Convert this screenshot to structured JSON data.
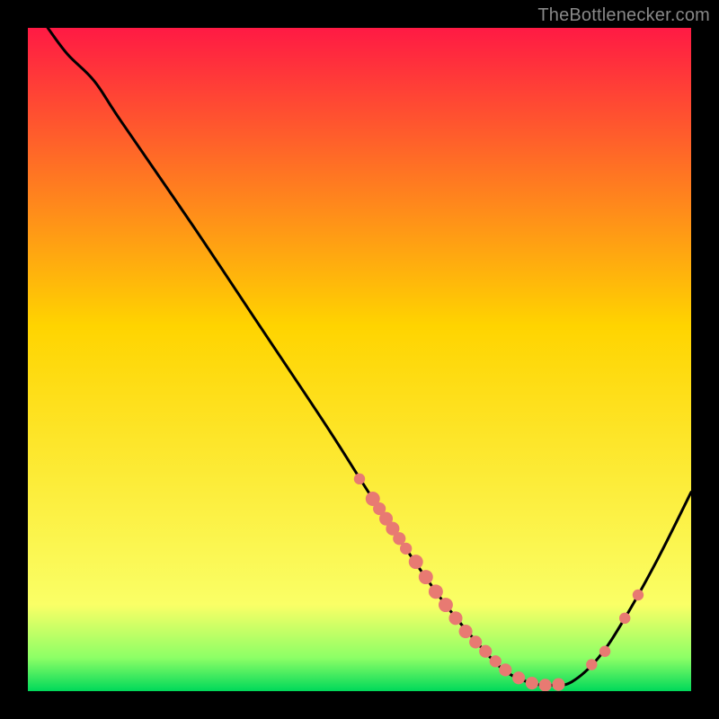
{
  "attribution": "TheBottlenecker.com",
  "colors": {
    "bg": "#000000",
    "curve": "#000000",
    "markers": "#e87a72",
    "grad_top": "#ff1a44",
    "grad_mid": "#ffd400",
    "grad_low1": "#faff66",
    "grad_low2": "#8cff66",
    "grad_bottom": "#00d85a"
  },
  "chart_data": {
    "type": "line",
    "title": "",
    "xlabel": "",
    "ylabel": "",
    "xlim": [
      0,
      100
    ],
    "ylim": [
      0,
      100
    ],
    "curve": [
      {
        "x": 3,
        "y": 100
      },
      {
        "x": 6,
        "y": 96
      },
      {
        "x": 10,
        "y": 92
      },
      {
        "x": 14,
        "y": 86
      },
      {
        "x": 25,
        "y": 70
      },
      {
        "x": 35,
        "y": 55
      },
      {
        "x": 45,
        "y": 40
      },
      {
        "x": 52,
        "y": 29
      },
      {
        "x": 58,
        "y": 20
      },
      {
        "x": 63,
        "y": 13
      },
      {
        "x": 68,
        "y": 7
      },
      {
        "x": 72,
        "y": 3
      },
      {
        "x": 76,
        "y": 1.2
      },
      {
        "x": 79,
        "y": 0.9
      },
      {
        "x": 82,
        "y": 1.4
      },
      {
        "x": 86,
        "y": 5
      },
      {
        "x": 90,
        "y": 11
      },
      {
        "x": 95,
        "y": 20
      },
      {
        "x": 100,
        "y": 30
      }
    ],
    "markers": [
      {
        "x": 50,
        "y": 32,
        "r": 1.4
      },
      {
        "x": 52,
        "y": 29,
        "r": 1.8
      },
      {
        "x": 53,
        "y": 27.5,
        "r": 1.6
      },
      {
        "x": 54,
        "y": 26,
        "r": 1.7
      },
      {
        "x": 55,
        "y": 24.5,
        "r": 1.7
      },
      {
        "x": 56,
        "y": 23,
        "r": 1.6
      },
      {
        "x": 57,
        "y": 21.5,
        "r": 1.5
      },
      {
        "x": 58.5,
        "y": 19.5,
        "r": 1.8
      },
      {
        "x": 60,
        "y": 17.2,
        "r": 1.8
      },
      {
        "x": 61.5,
        "y": 15,
        "r": 1.8
      },
      {
        "x": 63,
        "y": 13,
        "r": 1.8
      },
      {
        "x": 64.5,
        "y": 11,
        "r": 1.7
      },
      {
        "x": 66,
        "y": 9,
        "r": 1.7
      },
      {
        "x": 67.5,
        "y": 7.4,
        "r": 1.6
      },
      {
        "x": 69,
        "y": 6,
        "r": 1.6
      },
      {
        "x": 70.5,
        "y": 4.5,
        "r": 1.5
      },
      {
        "x": 72,
        "y": 3.2,
        "r": 1.6
      },
      {
        "x": 74,
        "y": 2,
        "r": 1.6
      },
      {
        "x": 76,
        "y": 1.2,
        "r": 1.6
      },
      {
        "x": 78,
        "y": 0.9,
        "r": 1.6
      },
      {
        "x": 80,
        "y": 1,
        "r": 1.6
      },
      {
        "x": 85,
        "y": 4,
        "r": 1.4
      },
      {
        "x": 87,
        "y": 6,
        "r": 1.4
      },
      {
        "x": 90,
        "y": 11,
        "r": 1.4
      },
      {
        "x": 92,
        "y": 14.5,
        "r": 1.4
      }
    ]
  }
}
